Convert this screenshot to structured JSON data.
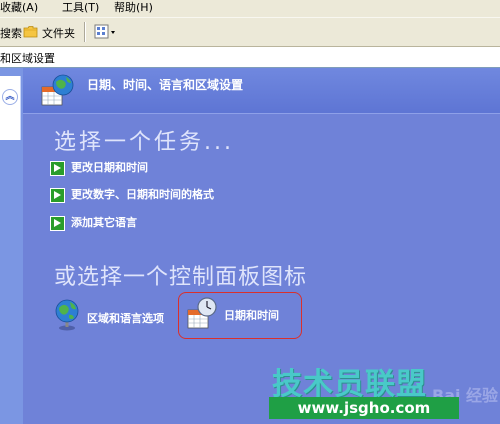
{
  "menubar": {
    "items": [
      {
        "label": "收藏(A)"
      },
      {
        "label": "工具(T)"
      },
      {
        "label": "帮助(H)"
      }
    ]
  },
  "toolbar": {
    "search_label": "搜索",
    "folders_label": "文件夹",
    "icons": [
      "folder-icon",
      "views-icon"
    ]
  },
  "address": {
    "text": "和区域设置"
  },
  "sidebar": {
    "collapse_glyph": "︽"
  },
  "header": {
    "title": "日期、时间、语言和区域设置",
    "icon": "globe-calendar-icon"
  },
  "tasks": {
    "heading": "选择一个任务...",
    "items": [
      {
        "label": "更改日期和时间"
      },
      {
        "label": "更改数字、日期和时间的格式"
      },
      {
        "label": "添加其它语言"
      }
    ]
  },
  "control_panel": {
    "heading": "或选择一个控制面板图标",
    "icons": [
      {
        "label": "区域和语言选项",
        "icon": "globe-icon"
      },
      {
        "label": "日期和时间",
        "icon": "clock-calendar-icon"
      }
    ]
  },
  "watermark": {
    "brand": "技术员联盟",
    "url": "www.jsgho.com",
    "faded": "Bai 经验"
  },
  "colors": {
    "content_bg": "#6f82d8",
    "highlight": "#d9302c",
    "task_arrow": "#2a9d2a"
  }
}
